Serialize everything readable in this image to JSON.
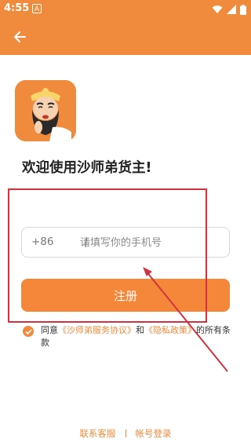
{
  "status": {
    "time": "4:55",
    "notification_badge": "A",
    "icons": [
      "wifi-icon",
      "signal-icon",
      "battery-icon"
    ]
  },
  "colors": {
    "accent": "#F08A3C",
    "button": "#F4873A",
    "annotation": "#D4323E"
  },
  "appbar": {
    "back_icon": "back-arrow-icon"
  },
  "welcome": "欢迎使用沙师弟货主!",
  "phone": {
    "prefix": "+86",
    "placeholder": "请填写你的手机号",
    "value": ""
  },
  "register_label": "注册",
  "agreement": {
    "checked": true,
    "prefix": "同意",
    "service_link": "《沙师弟服务协议》",
    "and": "和",
    "privacy_link": "《隐私政策》",
    "suffix": "的所有条款"
  },
  "footer": {
    "contact": "联系客服",
    "account_login": "帐号登录"
  }
}
